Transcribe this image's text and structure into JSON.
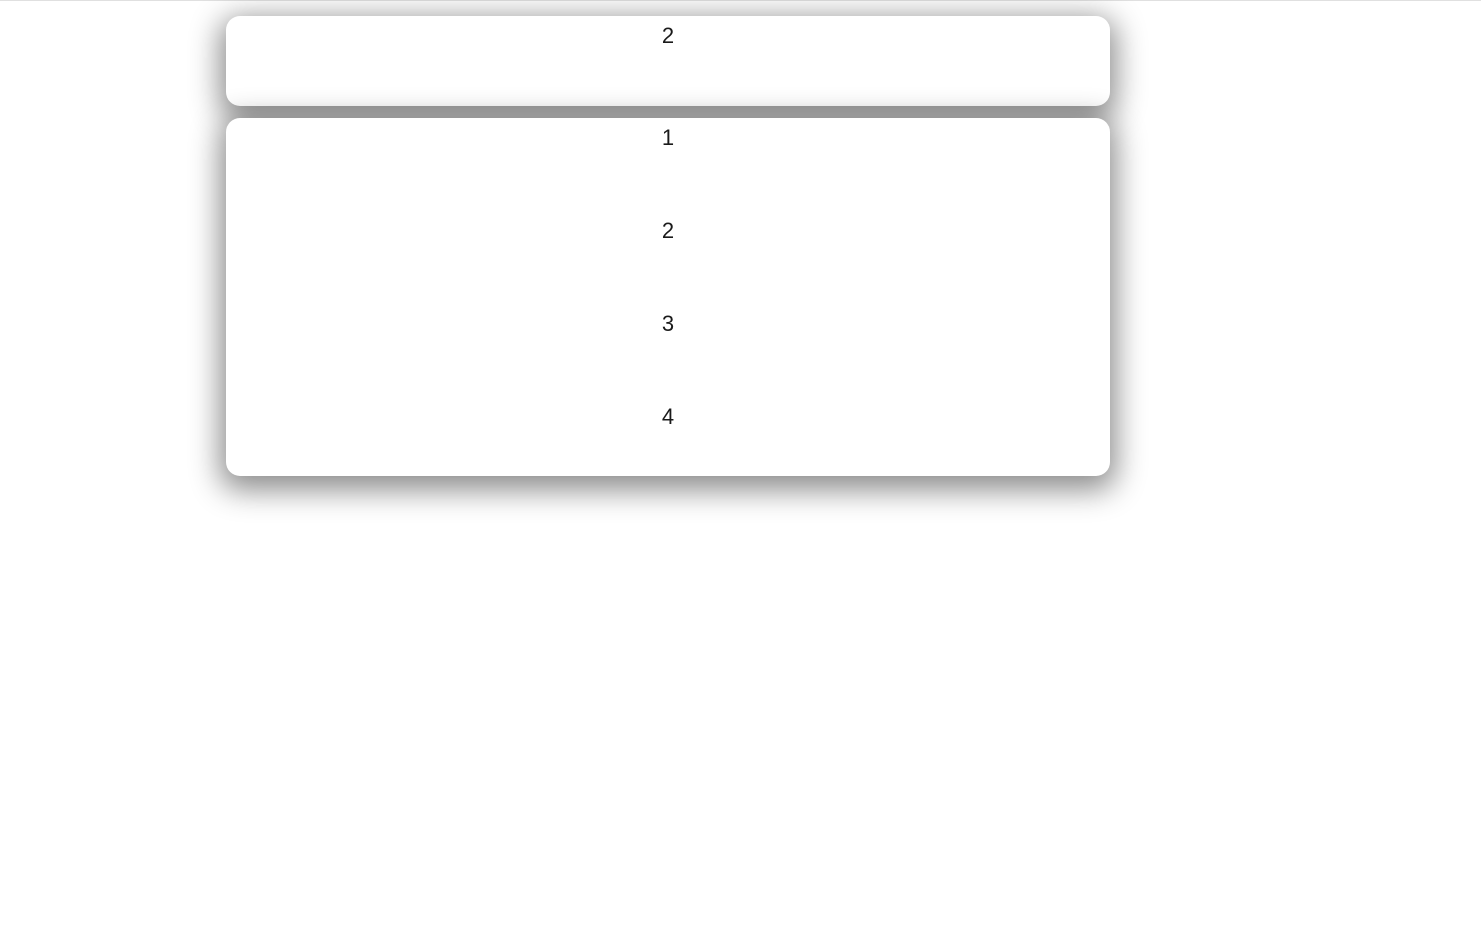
{
  "top_card": {
    "value": "2"
  },
  "bottom_card": {
    "items": [
      "1",
      "2",
      "3",
      "4"
    ]
  }
}
